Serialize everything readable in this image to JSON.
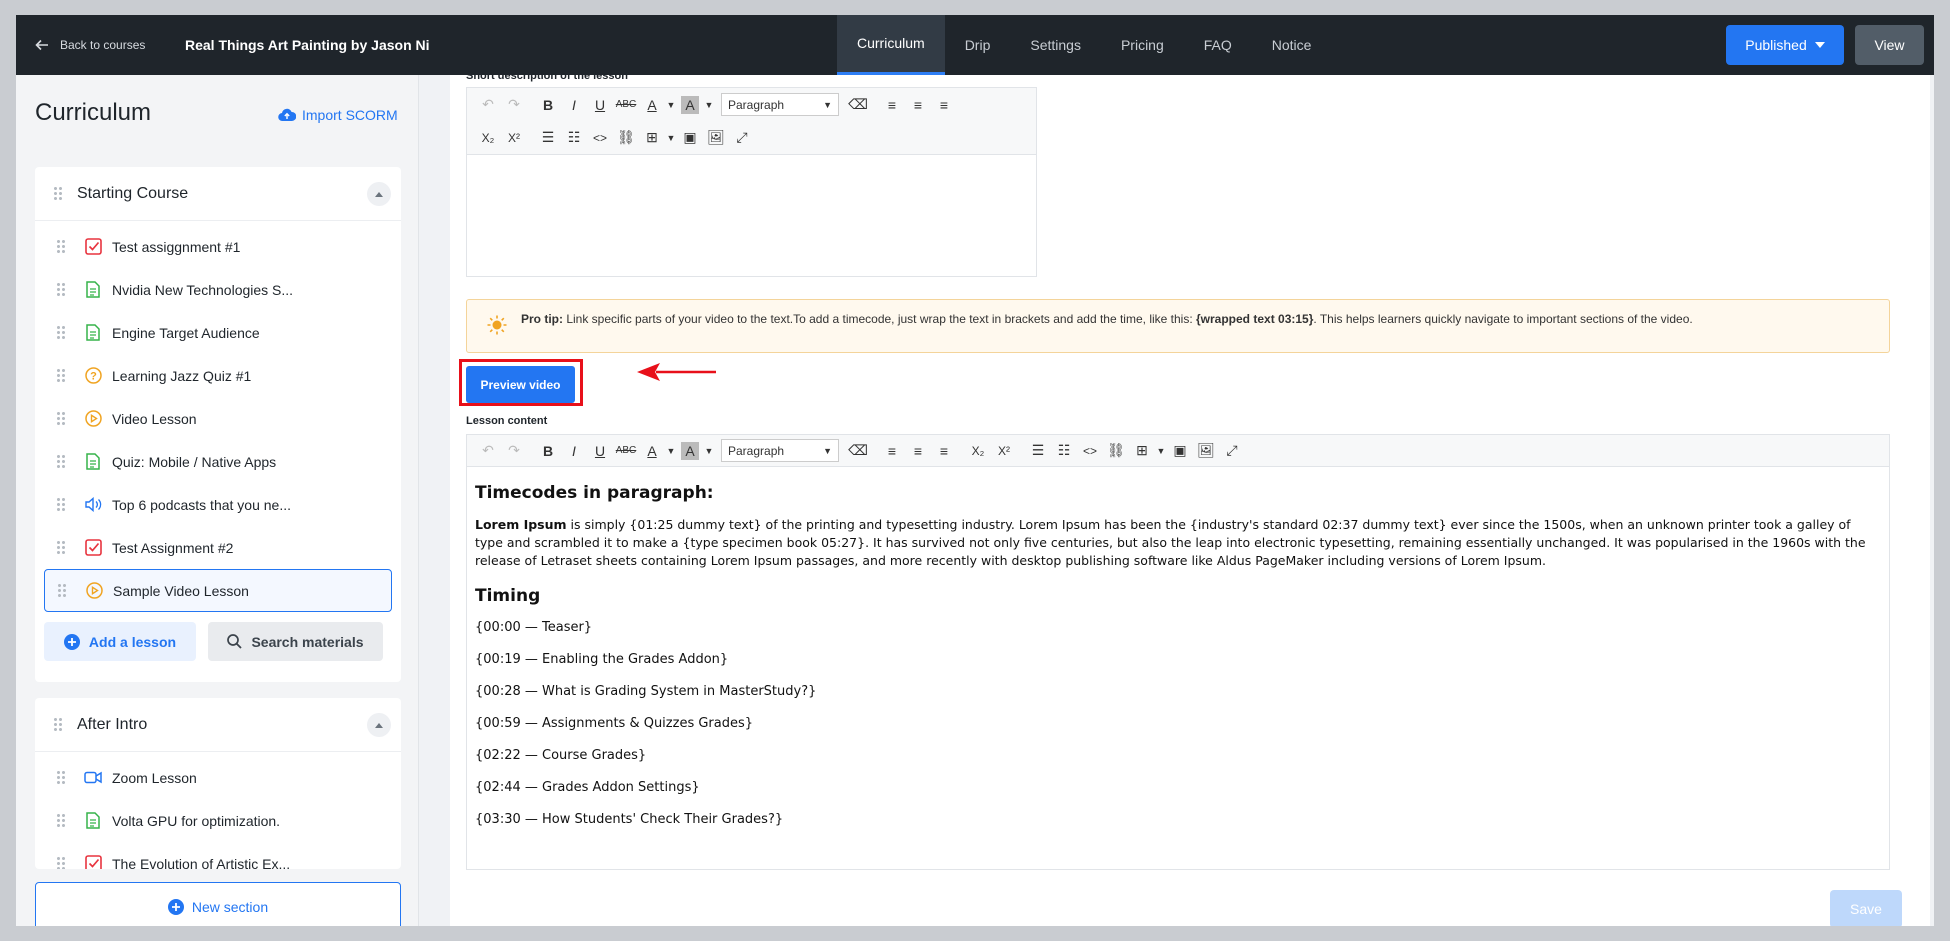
{
  "topbar": {
    "back_label": "Back to courses",
    "course_title": "Real Things Art Painting by Jason Ni",
    "tabs": [
      {
        "label": "Curriculum",
        "active": true
      },
      {
        "label": "Drip",
        "active": false
      },
      {
        "label": "Settings",
        "active": false
      },
      {
        "label": "Pricing",
        "active": false
      },
      {
        "label": "FAQ",
        "active": false
      },
      {
        "label": "Notice",
        "active": false
      }
    ],
    "published_label": "Published",
    "view_label": "View"
  },
  "sidebar": {
    "title": "Curriculum",
    "import_label": "Import SCORM",
    "sections": [
      {
        "title": "Starting Course",
        "lessons": [
          {
            "label": "Test assiggnment #1",
            "icon": "assignment-icon"
          },
          {
            "label": "Nvidia New Technologies S...",
            "icon": "text-lesson-icon"
          },
          {
            "label": "Engine Target Audience",
            "icon": "text-lesson-icon"
          },
          {
            "label": "Learning Jazz Quiz #1",
            "icon": "quiz-icon"
          },
          {
            "label": "Video Lesson",
            "icon": "video-icon"
          },
          {
            "label": "Quiz: Mobile / Native Apps",
            "icon": "text-lesson-icon"
          },
          {
            "label": "Top 6 podcasts that you ne...",
            "icon": "audio-icon"
          },
          {
            "label": "Test Assignment #2",
            "icon": "assignment-icon"
          },
          {
            "label": "Sample Video Lesson",
            "icon": "video-icon",
            "selected": true
          }
        ],
        "add_lesson_label": "Add a lesson",
        "search_materials_label": "Search materials"
      },
      {
        "title": "After Intro",
        "lessons": [
          {
            "label": "Zoom Lesson",
            "icon": "zoom-icon"
          },
          {
            "label": "Volta GPU for optimization.",
            "icon": "text-lesson-icon"
          },
          {
            "label": "The Evolution of Artistic Ex...",
            "icon": "assignment-icon"
          }
        ]
      }
    ],
    "new_section_label": "New section"
  },
  "main": {
    "short_description_label": "Short description of the lesson",
    "paragraph_format": "Paragraph",
    "tip": {
      "bold": "Pro tip:",
      "text1": " Link specific parts of your video to the text.To add a timecode, just wrap the text in brackets and add the time, like this: ",
      "example": "{wrapped text 03:15}",
      "text2": ". This helps learners quickly navigate to important sections of the video."
    },
    "preview_video_label": "Preview video",
    "lesson_content_label": "Lesson content",
    "content": {
      "heading1": "Timecodes in paragraph:",
      "para_bold": "Lorem Ipsum",
      "para_text": " is simply {01:25 dummy text} of the printing and typesetting industry. Lorem Ipsum has been the {industry's standard 02:37 dummy text} ever since the 1500s, when an unknown printer took a galley of type and scrambled it to make a {type specimen book 05:27}. It has survived not only five centuries, but also the leap into electronic typesetting, remaining essentially unchanged. It was popularised in the 1960s with the release of Letraset sheets containing Lorem Ipsum passages, and more recently with desktop publishing software like Aldus PageMaker including versions of Lorem Ipsum.",
      "heading2": "Timing",
      "timing": [
        "{00:00 — Teaser}",
        "{00:19 — Enabling the Grades Addon}",
        "{00:28 — What is Grading System in MasterStudy?}",
        "{00:59 — Assignments & Quizzes Grades}",
        "{02:22 — Course Grades}",
        "{02:44 — Grades Addon Settings}",
        "{03:30 — How Students' Check Their Grades?}"
      ]
    },
    "save_label": "Save"
  },
  "colors": {
    "accent": "#2376f2",
    "topbar": "#1f252b",
    "highlight": "#e8101a"
  }
}
